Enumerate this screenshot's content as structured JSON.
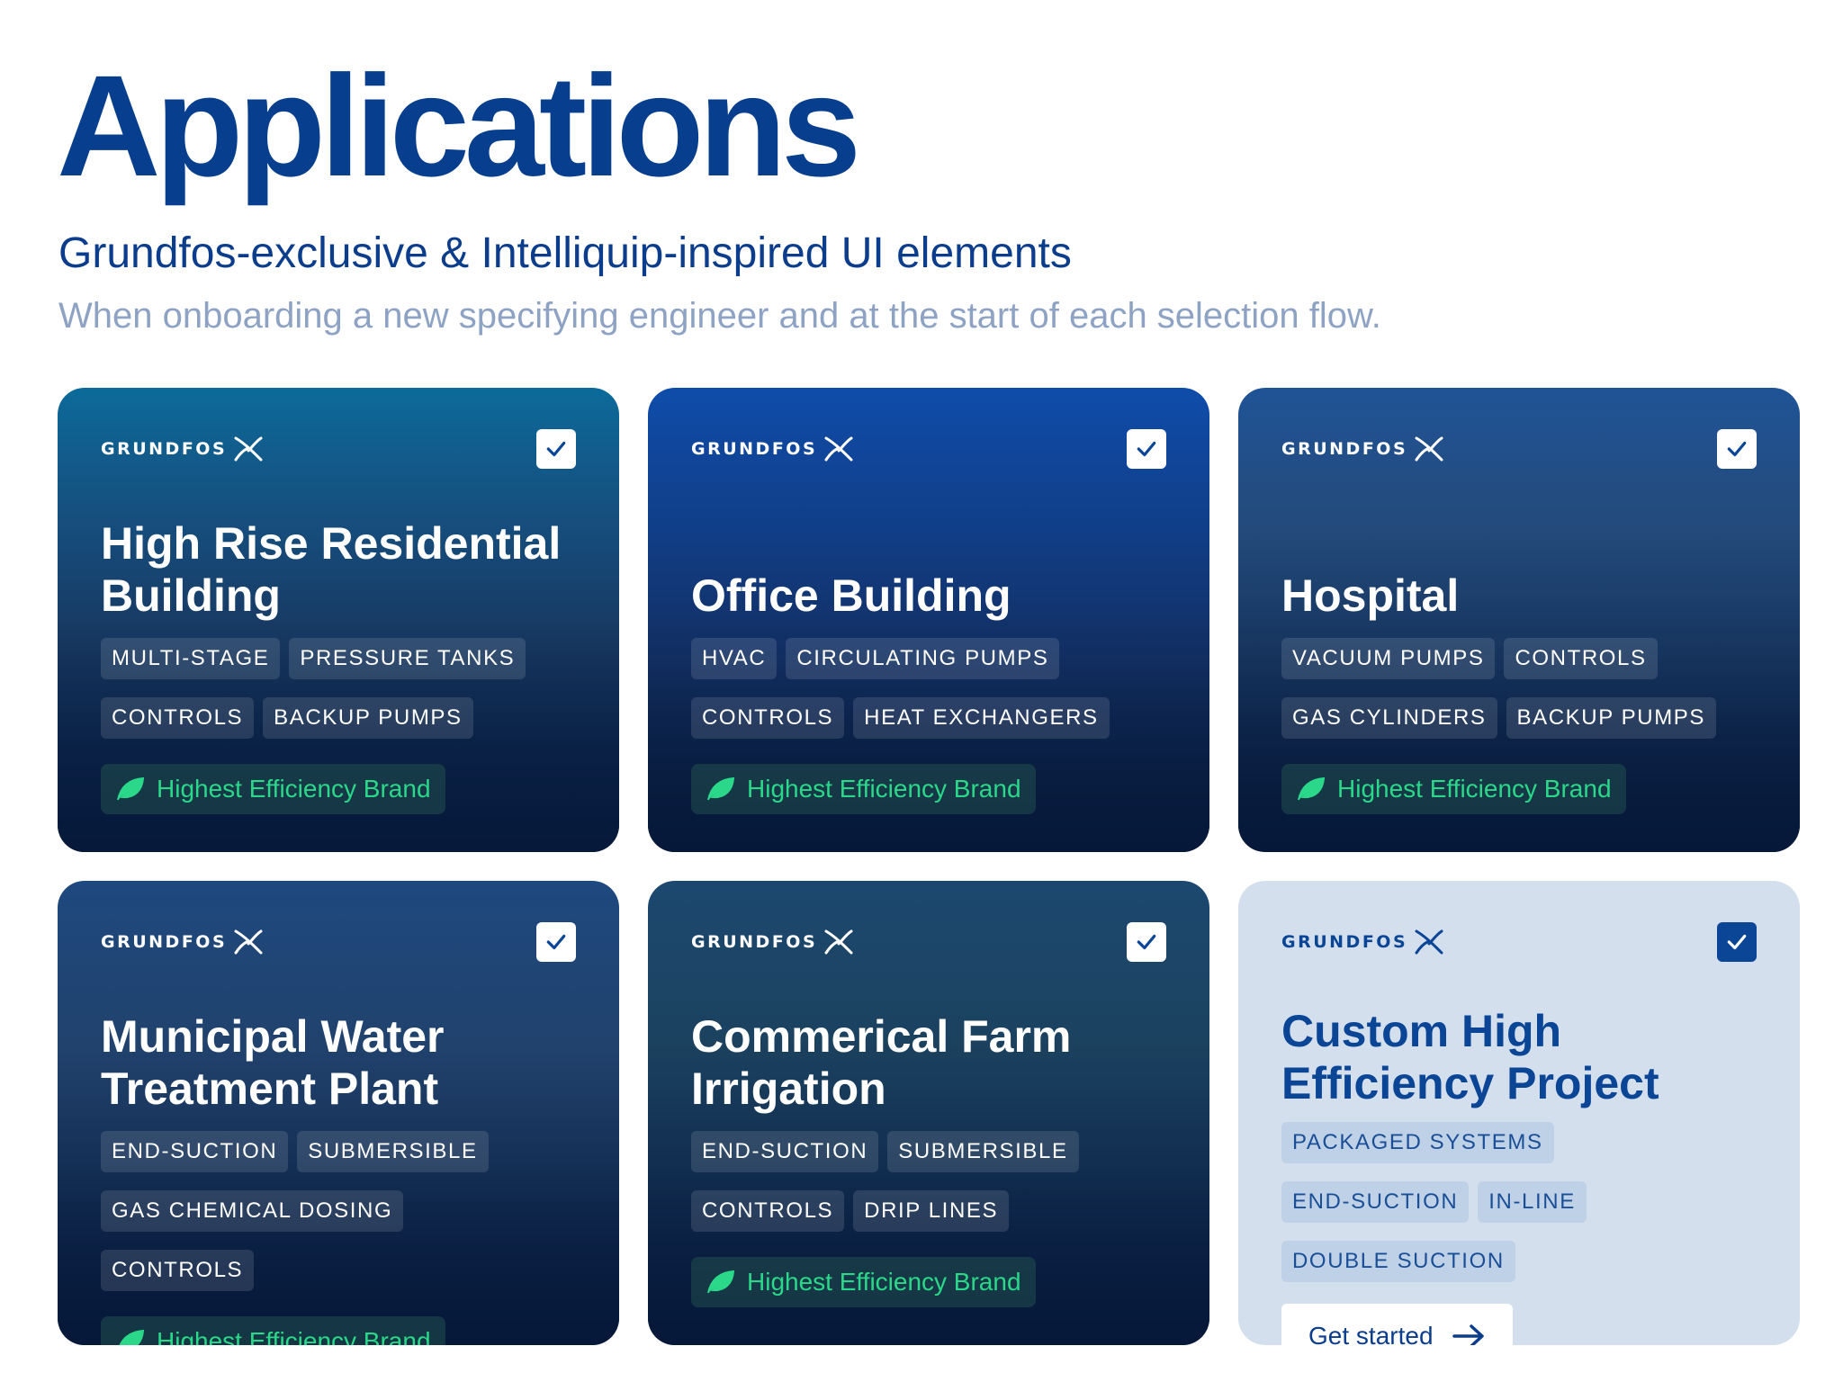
{
  "header": {
    "title": "Applications",
    "subtitle": "Grundfos-exclusive & Intelliquip-inspired UI elements",
    "description": "When onboarding a new specifying engineer and at the start of each selection flow."
  },
  "brand": {
    "wordmark": "GRUNDFOS"
  },
  "badge": {
    "label": "Highest Efficiency Brand",
    "icon": "leaf-icon",
    "color": "#2bd88a"
  },
  "colors": {
    "primary": "#073f8e",
    "muted": "#8ea3c4",
    "custom_card": "#d3dfec"
  },
  "cards": [
    {
      "title": "High Rise Residential Building",
      "tags": [
        "MULTI-STAGE",
        "PRESSURE TANKS",
        "CONTROLS",
        "BACKUP PUMPS"
      ],
      "checked": true
    },
    {
      "title": "Office Building",
      "tags": [
        "HVAC",
        "CIRCULATING PUMPS",
        "CONTROLS",
        "HEAT EXCHANGERS"
      ],
      "checked": true
    },
    {
      "title": "Hospital",
      "tags": [
        "VACUUM PUMPS",
        "CONTROLS",
        "GAS CYLINDERS",
        "BACKUP PUMPS"
      ],
      "checked": true
    },
    {
      "title": "Municipal Water Treatment Plant",
      "tags": [
        "END-SUCTION",
        "SUBMERSIBLE",
        "GAS CHEMICAL DOSING",
        "CONTROLS"
      ],
      "checked": true
    },
    {
      "title": "Commerical Farm Irrigation",
      "tags": [
        "END-SUCTION",
        "SUBMERSIBLE",
        "CONTROLS",
        "DRIP LINES"
      ],
      "checked": true
    },
    {
      "title": "Custom High Efficiency Project",
      "tags": [
        "PACKAGED SYSTEMS",
        "END-SUCTION",
        "IN-LINE",
        "DOUBLE SUCTION"
      ],
      "checked": true,
      "cta": "Get started"
    }
  ]
}
